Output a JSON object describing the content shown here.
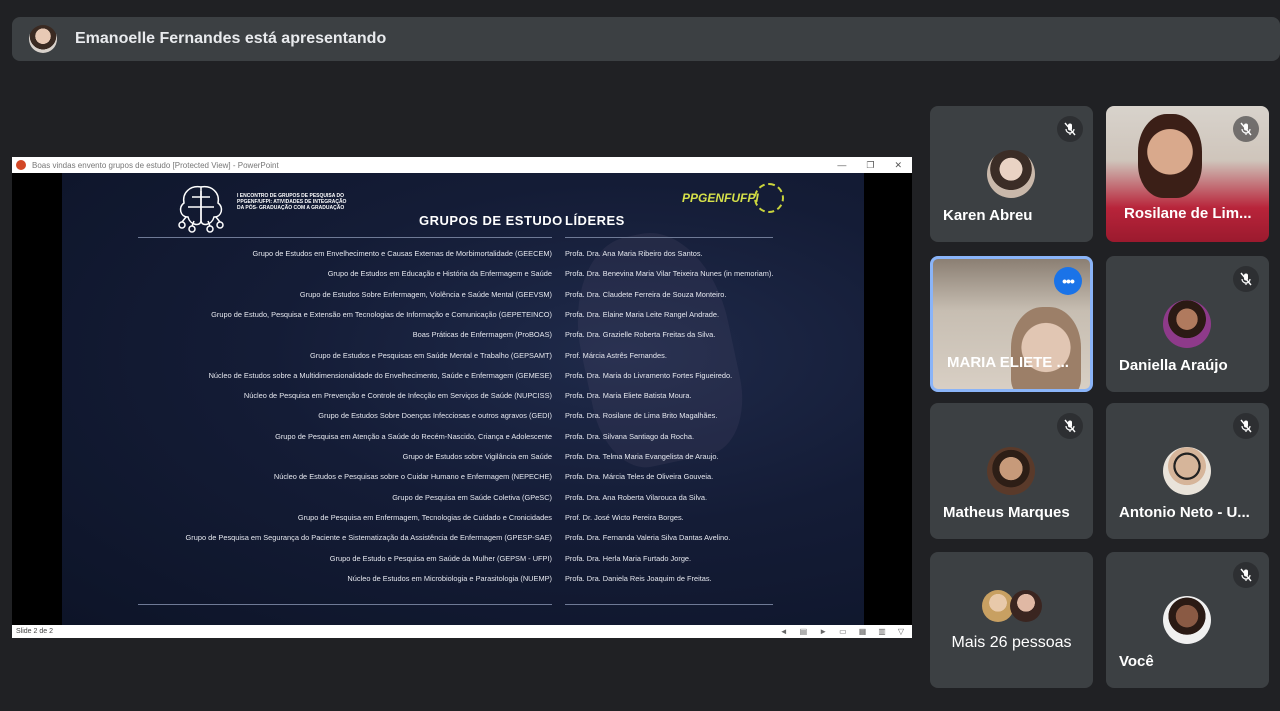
{
  "banner": {
    "text": "Emanoelle Fernandes está apresentando"
  },
  "presentation": {
    "window_title": "Boas vindas envento grupos de estudo [Protected View] - PowerPoint",
    "status": "Slide 2 de 2",
    "slide": {
      "event_title": "I ENCONTRO DE GRUPOS DE PESQUISA DO PPGENF/UFPI: ATIVIDADES DE INTEGRAÇÃO DA PÓS- GRADUAÇÃO COM A GRADUAÇÃO",
      "logo_text": "PPGENFUFPI",
      "col_groups": "GRUPOS DE ESTUDO",
      "col_leaders": "LÍDERES",
      "rows": [
        {
          "group": "Grupo de Estudos em Envelhecimento e Causas Externas de Morbimortalidade (GEECEM)",
          "leader": "Profa. Dra. Ana Maria Ribeiro dos Santos."
        },
        {
          "group": "Grupo de Estudos em Educação e História da Enfermagem e Saúde",
          "leader": "Profa. Dra. Benevina Maria Vilar Teixeira Nunes (in memoriam)."
        },
        {
          "group": "Grupo de Estudos Sobre Enfermagem, Violência e Saúde Mental (GEEVSM)",
          "leader": "Profa. Dra. Claudete Ferreira de Souza Monteiro."
        },
        {
          "group": "Grupo de Estudo, Pesquisa e Extensão em Tecnologias de Informação e Comunicação (GEPETEINCO)",
          "leader": "Profa. Dra. Elaine Maria Leite Rangel Andrade."
        },
        {
          "group": "Boas Práticas de Enfermagem (ProBOAS)",
          "leader": "Profa. Dra. Grazielle Roberta Freitas da Silva."
        },
        {
          "group": "Grupo de Estudos e Pesquisas em Saúde Mental e Trabalho (GEPSAMT)",
          "leader": "Prof. Márcia Astrês Fernandes."
        },
        {
          "group": "Núcleo de Estudos sobre a Multidimensionalidade do Envelhecimento, Saúde e Enfermagem (GEMESE)",
          "leader": "Profa. Dra. Maria do Livramento Fortes Figueiredo."
        },
        {
          "group": "Núcleo de Pesquisa em Prevenção e Controle de Infecção em Serviços de Saúde (NUPCISS)",
          "leader": "Profa. Dra. Maria Eliete Batista Moura."
        },
        {
          "group": "Grupo de Estudos Sobre Doenças Infecciosas e outros agravos (GEDI)",
          "leader": "Profa. Dra. Rosilane de Lima Brito Magalhães."
        },
        {
          "group": "Grupo de Pesquisa em Atenção a Saúde do Recém-Nascido, Criança e Adolescente",
          "leader": "Profa. Dra. Silvana Santiago da Rocha."
        },
        {
          "group": "Grupo de Estudos sobre Vigilância em Saúde",
          "leader": "Profa. Dra. Telma Maria Evangelista de Araujo."
        },
        {
          "group": "Núcleo de Estudos e Pesquisas sobre o Cuidar Humano e Enfermagem (NEPECHE)",
          "leader": "Profa. Dra. Márcia Teles de Oliveira Gouveia."
        },
        {
          "group": "Grupo de Pesquisa em Saúde Coletiva (GPeSC)",
          "leader": "Profa. Dra. Ana Roberta Vilarouca da Silva."
        },
        {
          "group": "Grupo de Pesquisa em Enfermagem, Tecnologias de  Cuidado e Cronicidades",
          "leader": "Prof. Dr. José Wicto Pereira Borges."
        },
        {
          "group": "Grupo de Pesquisa em Segurança do Paciente e Sistematização da Assistência de Enfermagem (GPESP-SAE)",
          "leader": "Profa. Dra. Fernanda Valeria Silva Dantas Avelino."
        },
        {
          "group": "Grupo de Estudo e Pesquisa em Saúde da Mulher (GEPSM - UFPI)",
          "leader": "Profa. Dra. Herla Maria Furtado Jorge."
        },
        {
          "group": "Núcleo de Estudos em Microbiologia e Parasitologia (NUEMP)",
          "leader": "Profa. Dra. Daniela Reis Joaquim de Freitas."
        }
      ]
    }
  },
  "participants": [
    {
      "name": "Karen Abreu",
      "muted": true,
      "avatar_color": "#c9b8aa"
    },
    {
      "name": "Rosilane de Lim...",
      "muted": true,
      "video": true
    },
    {
      "name": "MARIA ELIETE ...",
      "active": true,
      "video": true
    },
    {
      "name": "Daniella Araújo",
      "muted": true,
      "avatar_color": "#7a4a3a"
    },
    {
      "name": "Matheus Marques",
      "muted": true,
      "avatar_color": "#5a3a2a"
    },
    {
      "name": "Antonio Neto - U...",
      "muted": true,
      "avatar_color": "#d6b59a"
    },
    {
      "name": "Você",
      "muted": true,
      "avatar_color": "#4a2f26"
    }
  ],
  "others": {
    "label": "Mais 26 pessoas"
  },
  "colors": {
    "background": "#202124",
    "tile": "#3c4043",
    "accent": "#1a73e8",
    "active_border": "#8ab4f8"
  },
  "icons": {
    "muted": "mic-off-icon",
    "more": "more-options-icon"
  }
}
